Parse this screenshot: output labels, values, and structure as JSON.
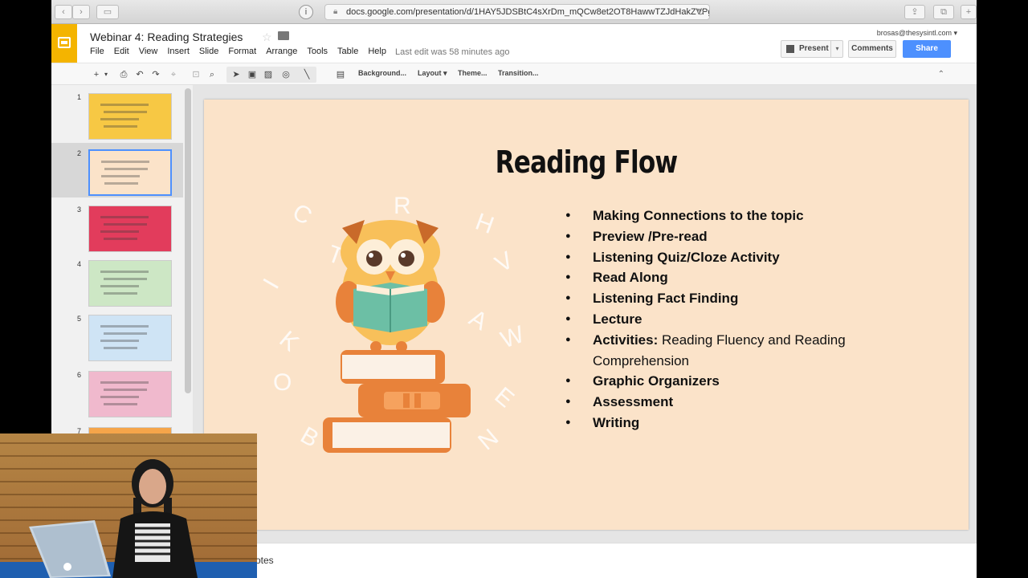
{
  "browser": {
    "url": "docs.google.com/presentation/d/1HAY5JDSBtC4sXrDm_mQCw8et2OT8HawwTZJdHakZVPg"
  },
  "doc": {
    "title": "Webinar 4: Reading Strategies",
    "last_edit": "Last edit was 58 minutes ago",
    "user_email": "brosas@thesysintl.com"
  },
  "menu": [
    "File",
    "Edit",
    "View",
    "Insert",
    "Slide",
    "Format",
    "Arrange",
    "Tools",
    "Table",
    "Help"
  ],
  "header_buttons": {
    "present": "Present",
    "comments": "Comments",
    "share": "Share"
  },
  "toolbar": {
    "background": "Background...",
    "layout": "Layout",
    "theme": "Theme...",
    "transition": "Transition..."
  },
  "filmstrip": {
    "slides": [
      {
        "num": "1",
        "color": "#f7c844"
      },
      {
        "num": "2",
        "color": "#fbe3c9"
      },
      {
        "num": "3",
        "color": "#e23c5c"
      },
      {
        "num": "4",
        "color": "#cde7c5"
      },
      {
        "num": "5",
        "color": "#cfe4f5"
      },
      {
        "num": "6",
        "color": "#f0b9cd"
      },
      {
        "num": "7",
        "color": "#f5a54a"
      }
    ],
    "selected": "2"
  },
  "slide": {
    "title": "Reading Flow",
    "bullets": [
      {
        "bold": "Making Connections to the topic",
        "rest": ""
      },
      {
        "bold": "Preview /Pre-read",
        "rest": ""
      },
      {
        "bold": "Listening Quiz/Cloze Activity",
        "rest": ""
      },
      {
        "bold": "Read Along",
        "rest": ""
      },
      {
        "bold": "Listening Fact Finding",
        "rest": ""
      },
      {
        "bold": "Lecture",
        "rest": ""
      },
      {
        "bold": "Activities:",
        "rest": " Reading Fluency and Reading Comprehension"
      },
      {
        "bold": "Graphic Organizers",
        "rest": ""
      },
      {
        "bold": "Assessment",
        "rest": ""
      },
      {
        "bold": "Writing",
        "rest": ""
      }
    ],
    "letters": [
      "R",
      "H",
      "V",
      "A",
      "W",
      "E",
      "N",
      "B",
      "O",
      "K",
      "I",
      "T",
      "C"
    ]
  },
  "notes": {
    "label": "otes"
  },
  "colors": {
    "accent_blue": "#4d90fe",
    "slides_yellow": "#f4b400",
    "slide_bg": "#fbe3c9"
  }
}
